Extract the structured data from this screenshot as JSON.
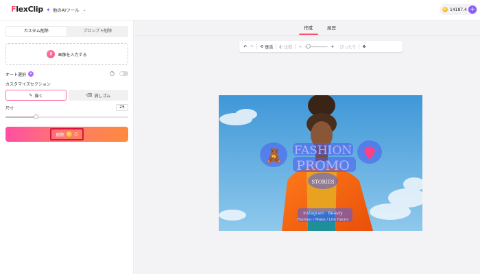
{
  "header": {
    "logo_prefix": "F",
    "logo_rest": "lexClip",
    "ai_tools_label": "他のAIツール",
    "credits": "14187.4"
  },
  "left_panel": {
    "tabs": [
      {
        "label": "カスタム削除",
        "active": true
      },
      {
        "label": "プロンプト削除",
        "active": false
      }
    ],
    "upload_label": "画像を入力する",
    "auto_select_label": "オート選択",
    "auto_badge": "✦",
    "section_label": "カスタマイズセクション",
    "tools": [
      {
        "label": "描く",
        "active": true
      },
      {
        "label": "消しゴム",
        "active": false
      }
    ],
    "size_label": "尺寸",
    "size_value": "25",
    "size_fraction": 0.25,
    "erase_label": "削除",
    "erase_cost": "-5"
  },
  "workspace": {
    "tabs": [
      {
        "label": "作成",
        "active": true
      },
      {
        "label": "履歴",
        "active": false
      }
    ],
    "toolbar": {
      "reset_label": "復活",
      "compare_label": "比較",
      "zoom_fit_label": "ぴったり"
    }
  },
  "canvas": {
    "text_line1": "FASHION",
    "text_line2": "PROMO",
    "text_stories": "STORIES",
    "text_instagram": "Instagram · Beauty",
    "text_tags": "Fashion / Make / Life Hacks"
  },
  "colors": {
    "accent_pink": "#ff4d6d",
    "accent_purple": "#8a5cf6",
    "mask_blue": "#4a5cf0"
  }
}
